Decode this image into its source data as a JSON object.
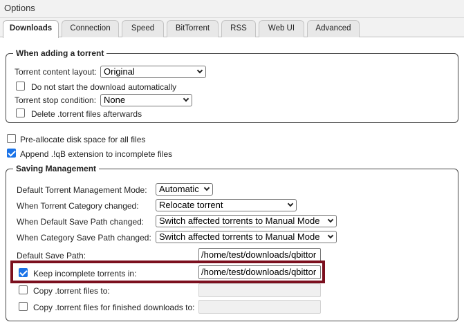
{
  "window": {
    "title": "Options"
  },
  "tabs": [
    {
      "label": "Downloads",
      "active": true
    },
    {
      "label": "Connection",
      "active": false
    },
    {
      "label": "Speed",
      "active": false
    },
    {
      "label": "BitTorrent",
      "active": false
    },
    {
      "label": "RSS",
      "active": false
    },
    {
      "label": "Web UI",
      "active": false
    },
    {
      "label": "Advanced",
      "active": false
    }
  ],
  "adding": {
    "legend": "When adding a torrent",
    "layout_label": "Torrent content layout:",
    "layout_value": "Original",
    "no_start_label": "Do not start the download automatically",
    "no_start_checked": false,
    "stop_condition_label": "Torrent stop condition:",
    "stop_condition_value": "None",
    "delete_label": "Delete .torrent files afterwards",
    "delete_checked": false
  },
  "general": {
    "preallocate_label": "Pre-allocate disk space for all files",
    "preallocate_checked": false,
    "append_label": "Append .!qB extension to incomplete files",
    "append_checked": true
  },
  "saving": {
    "legend": "Saving Management",
    "mode_label": "Default Torrent Management Mode:",
    "mode_value": "Automatic",
    "category_changed_label": "When Torrent Category changed:",
    "category_changed_value": "Relocate torrent",
    "default_path_changed_label": "When Default Save Path changed:",
    "default_path_changed_value": "Switch affected torrents to Manual Mode",
    "category_path_changed_label": "When Category Save Path changed:",
    "category_path_changed_value": "Switch affected torrents to Manual Mode",
    "default_path_label": "Default Save Path:",
    "default_path_value": "/home/test/downloads/qbittor",
    "keep_incomplete_label": "Keep incomplete torrents in:",
    "keep_incomplete_checked": true,
    "keep_incomplete_value": "/home/test/downloads/qbittor",
    "copy_label": "Copy .torrent files to:",
    "copy_checked": false,
    "copy_value": "",
    "copy_finished_label": "Copy .torrent files for finished downloads to:",
    "copy_finished_checked": false,
    "copy_finished_value": ""
  },
  "colors": {
    "accent": "#1a73e8",
    "highlight_border": "#7b0f1e"
  }
}
